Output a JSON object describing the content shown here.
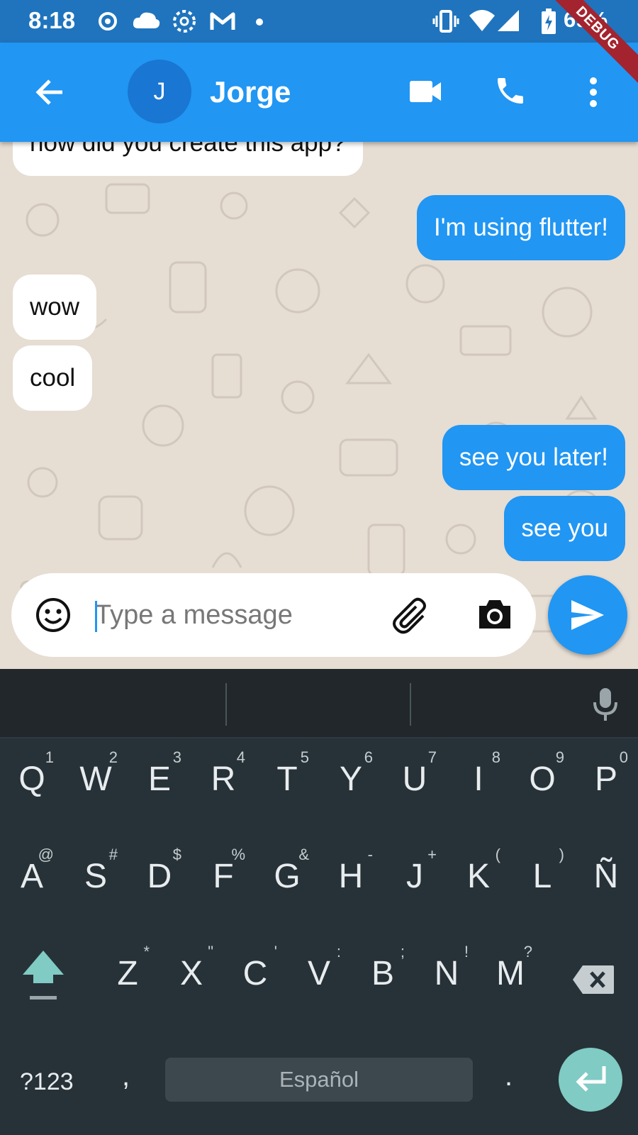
{
  "status_bar": {
    "time": "8:18",
    "battery": "69%",
    "debug_banner": "DEBUG",
    "icons": [
      "radio-icon",
      "cloud-chat-icon",
      "circle-app-icon",
      "gmail-icon",
      "dot-icon",
      "vibrate-icon",
      "wifi-icon",
      "signal-icon",
      "battery-charging-icon"
    ]
  },
  "app_bar": {
    "back_icon": "arrow-back-icon",
    "avatar_initial": "J",
    "contact_name": "Jorge",
    "actions": [
      "videocam-icon",
      "call-icon",
      "more-vert-icon"
    ],
    "color": "#2196f3"
  },
  "messages": [
    {
      "text": "how did you create this app?",
      "sender": "them"
    },
    {
      "text": "I'm using flutter!",
      "sender": "me"
    },
    {
      "text": "wow",
      "sender": "them"
    },
    {
      "text": "cool",
      "sender": "them"
    },
    {
      "text": "see you later!",
      "sender": "me"
    },
    {
      "text": "see you",
      "sender": "me"
    }
  ],
  "input": {
    "placeholder": "Type a message",
    "value": "",
    "emoji_icon": "emoji-icon",
    "attach_icon": "attach-icon",
    "camera_icon": "camera-icon",
    "send_icon": "send-icon"
  },
  "keyboard": {
    "row1": [
      {
        "key": "Q",
        "sup": "1"
      },
      {
        "key": "W",
        "sup": "2"
      },
      {
        "key": "E",
        "sup": "3"
      },
      {
        "key": "R",
        "sup": "4"
      },
      {
        "key": "T",
        "sup": "5"
      },
      {
        "key": "Y",
        "sup": "6"
      },
      {
        "key": "U",
        "sup": "7"
      },
      {
        "key": "I",
        "sup": "8"
      },
      {
        "key": "O",
        "sup": "9"
      },
      {
        "key": "P",
        "sup": "0"
      }
    ],
    "row2": [
      {
        "key": "A",
        "sup": "@"
      },
      {
        "key": "S",
        "sup": "#"
      },
      {
        "key": "D",
        "sup": "$"
      },
      {
        "key": "F",
        "sup": "%"
      },
      {
        "key": "G",
        "sup": "&"
      },
      {
        "key": "H",
        "sup": "-"
      },
      {
        "key": "J",
        "sup": "+"
      },
      {
        "key": "K",
        "sup": "("
      },
      {
        "key": "L",
        "sup": ")"
      },
      {
        "key": "Ñ",
        "sup": ""
      }
    ],
    "row3": [
      {
        "key": "Z",
        "sup": "*"
      },
      {
        "key": "X",
        "sup": "\""
      },
      {
        "key": "C",
        "sup": "'"
      },
      {
        "key": "V",
        "sup": ":"
      },
      {
        "key": "B",
        "sup": ";"
      },
      {
        "key": "N",
        "sup": "!"
      },
      {
        "key": "M",
        "sup": "?"
      }
    ],
    "symbols_label": "?123",
    "comma": ",",
    "space_label": "Español",
    "period": ".",
    "shift_icon": "shift-icon",
    "backspace_icon": "backspace-icon",
    "mic_icon": "mic-icon",
    "enter_icon": "enter-icon",
    "accent": "#80cbc4"
  }
}
